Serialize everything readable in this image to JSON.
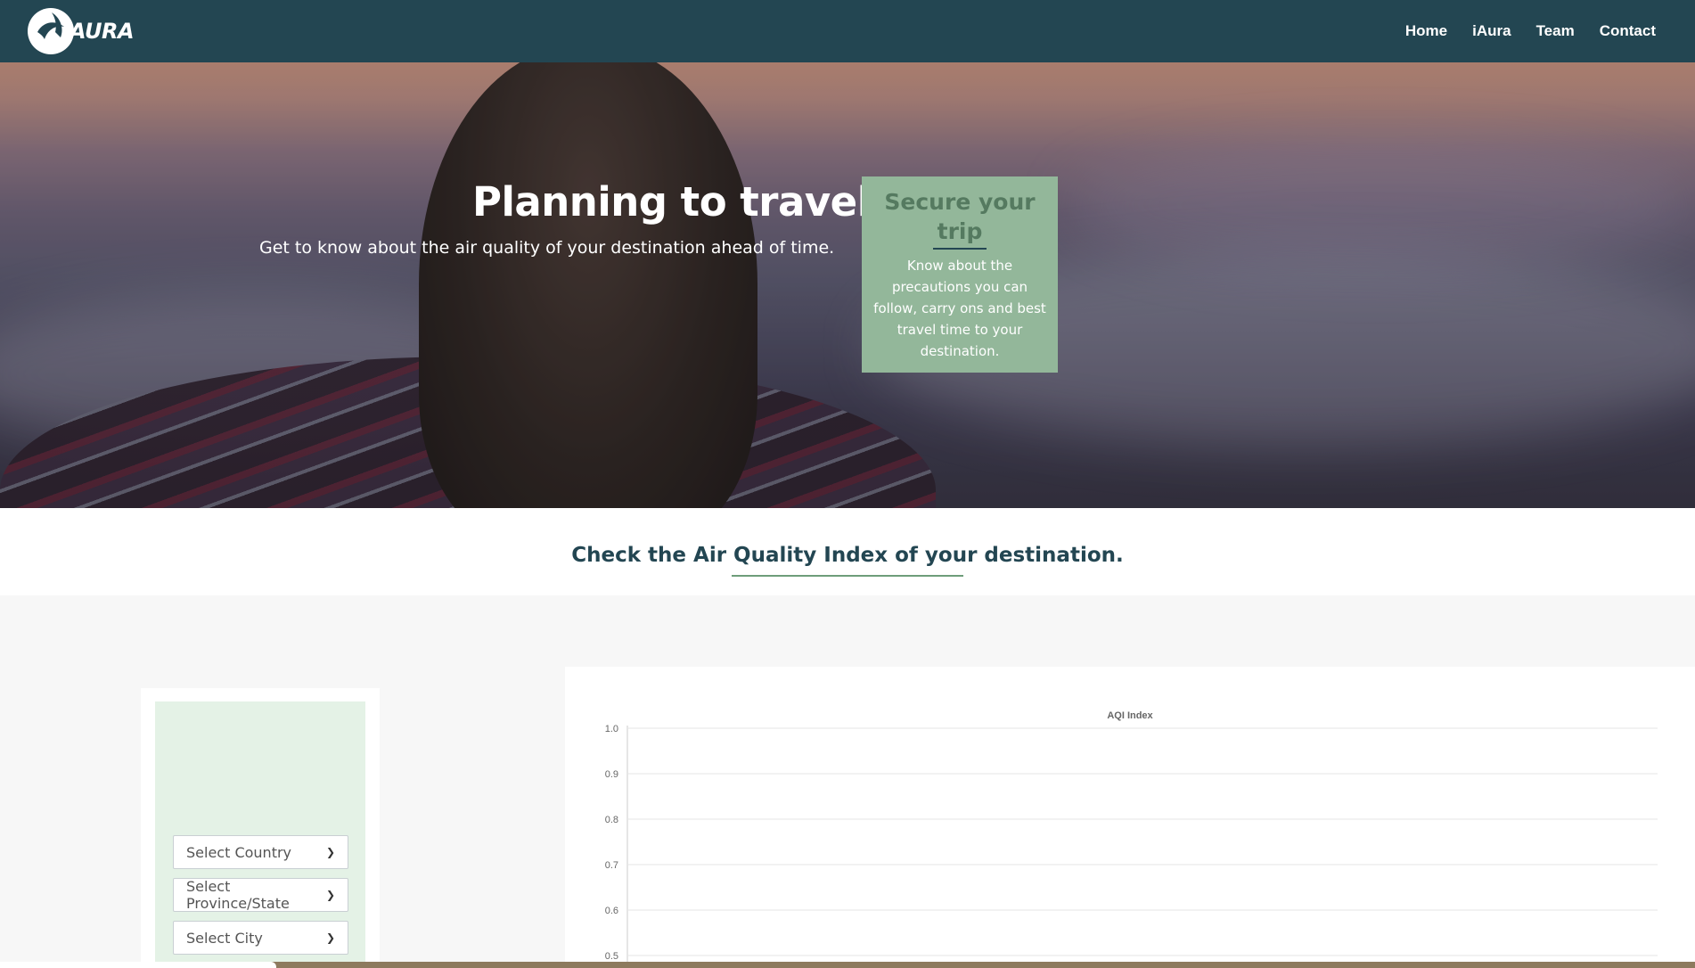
{
  "nav": {
    "logo_text": "AURA",
    "links": [
      "Home",
      "iAura",
      "Team",
      "Contact"
    ]
  },
  "hero": {
    "title": "Planning to travel?",
    "subtitle": "Get to know about the air quality of your destination ahead of time."
  },
  "secure": {
    "title": "Secure your trip",
    "text": "Know about the precautions you can follow, carry ons and best travel time to your destination."
  },
  "aqi_section": {
    "heading": "Check the Air Quality Index of your destination."
  },
  "selectors": {
    "country": "Select Country",
    "province": "Select Province/State",
    "city": "Select City"
  },
  "colors": {
    "nav_bg": "#234652",
    "secure_bg": "#93b79a",
    "selector_bg": "#e4f2e6",
    "accent_line": "#6e9d7a"
  },
  "chart_data": {
    "type": "line",
    "title": "AQI Index",
    "xlabel": "",
    "ylabel": "",
    "ylim": [
      0.5,
      1.0
    ],
    "y_ticks": [
      "1.0",
      "0.9",
      "0.8",
      "0.7",
      "0.6",
      "0.5"
    ],
    "grid": true,
    "series": []
  }
}
